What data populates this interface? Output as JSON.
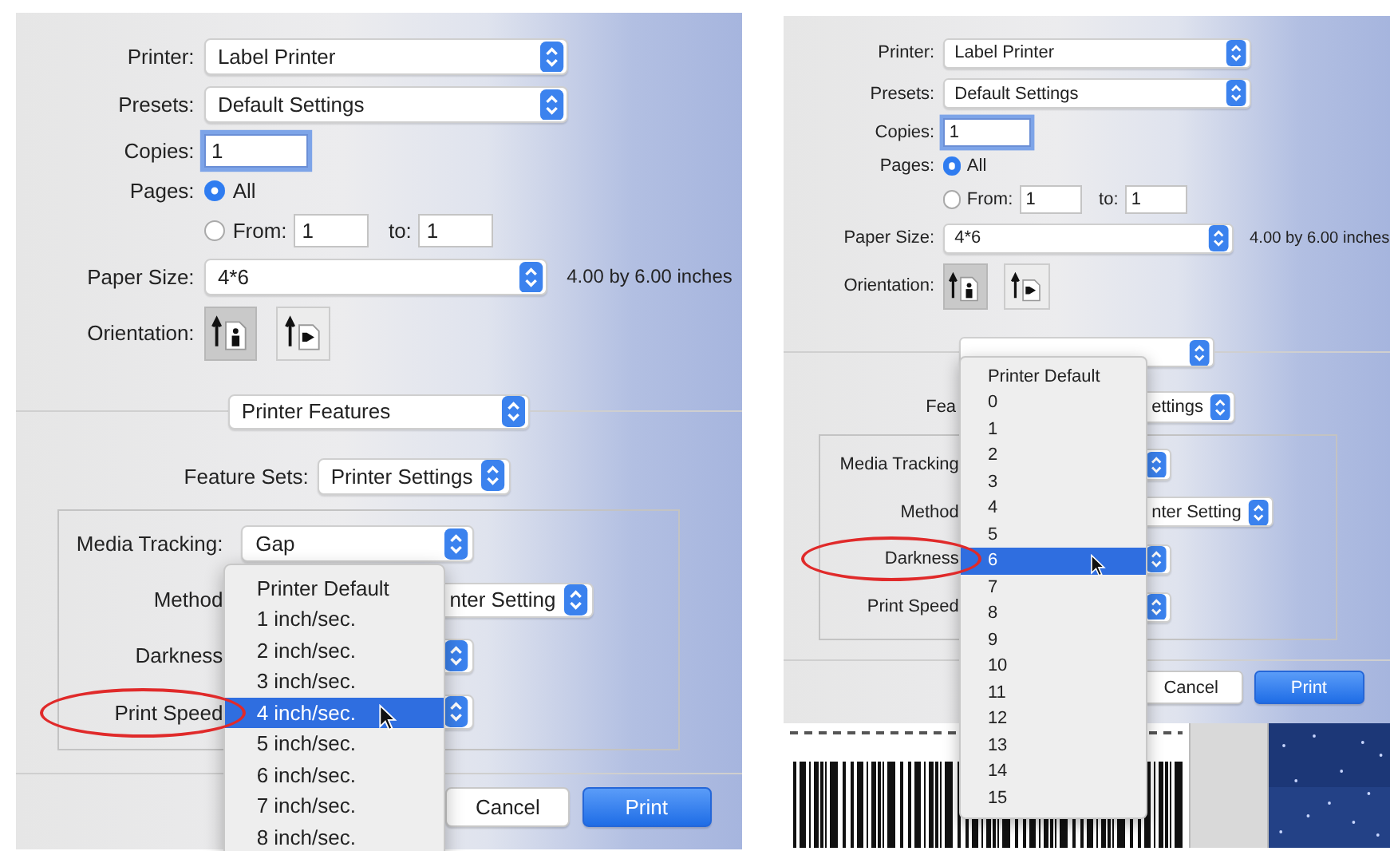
{
  "panels": [
    {
      "printer": {
        "label": "Printer:",
        "value": "Label Printer"
      },
      "presets": {
        "label": "Presets:",
        "value": "Default Settings"
      },
      "copies": {
        "label": "Copies:",
        "value": "1",
        "focused": true
      },
      "pages": {
        "label": "Pages:",
        "all": {
          "label": "All",
          "selected": true
        },
        "range": {
          "label": "From:",
          "selected": false,
          "from": "1",
          "to_label": "to:",
          "to": "1"
        }
      },
      "paper_size": {
        "label": "Paper Size:",
        "value": "4*6",
        "note": "4.00 by 6.00 inches"
      },
      "orientation": {
        "label": "Orientation:",
        "options": [
          {
            "kind": "portrait",
            "selected": true
          },
          {
            "kind": "landscape",
            "selected": false
          }
        ]
      },
      "section": {
        "value": "Printer Features"
      },
      "feature_sets": {
        "label": "Feature Sets:",
        "value": "Printer Settings"
      },
      "settings": [
        {
          "label": "Media Tracking:",
          "value": "Gap",
          "highlighted": false
        },
        {
          "label": "Method",
          "value": "nter Setting",
          "highlighted": false
        },
        {
          "label": "Darkness",
          "highlighted": false
        },
        {
          "label": "Print Speed",
          "highlighted": true
        }
      ],
      "menu": {
        "items": [
          {
            "label": "Printer Default",
            "selected": false
          },
          {
            "label": "1 inch/sec.",
            "selected": false
          },
          {
            "label": "2 inch/sec.",
            "selected": false
          },
          {
            "label": "3 inch/sec.",
            "selected": false
          },
          {
            "label": "4 inch/sec.",
            "selected": true
          },
          {
            "label": "5 inch/sec.",
            "selected": false
          },
          {
            "label": "6 inch/sec.",
            "selected": false
          },
          {
            "label": "7 inch/sec.",
            "selected": false
          },
          {
            "label": "8 inch/sec.",
            "selected": false
          }
        ]
      },
      "buttons": [
        {
          "label": "Cancel",
          "kind": "secondary"
        },
        {
          "label": "Print",
          "kind": "default"
        }
      ]
    },
    {
      "printer": {
        "label": "Printer:",
        "value": "Label Printer"
      },
      "presets": {
        "label": "Presets:",
        "value": "Default Settings"
      },
      "copies": {
        "label": "Copies:",
        "value": "1",
        "focused": true
      },
      "pages": {
        "label": "Pages:",
        "all": {
          "label": "All",
          "selected": true
        },
        "range": {
          "label": "From:",
          "selected": false,
          "from": "1",
          "to_label": "to:",
          "to": "1"
        }
      },
      "paper_size": {
        "label": "Paper Size:",
        "value": "4*6",
        "note": "4.00 by 6.00 inches"
      },
      "orientation": {
        "label": "Orientation:",
        "options": [
          {
            "kind": "portrait",
            "selected": true
          },
          {
            "kind": "landscape",
            "selected": false
          }
        ]
      },
      "feature_sets": {
        "label": "Fea",
        "value": "ettings"
      },
      "settings": [
        {
          "label": "Media Tracking",
          "highlighted": false
        },
        {
          "label": "Method",
          "value": "nter Setting",
          "highlighted": false
        },
        {
          "label": "Darkness",
          "highlighted": true
        },
        {
          "label": "Print Speed",
          "highlighted": false
        }
      ],
      "menu": {
        "items": [
          {
            "label": "Printer Default",
            "selected": false
          },
          {
            "label": "0",
            "selected": false
          },
          {
            "label": "1",
            "selected": false
          },
          {
            "label": "2",
            "selected": false
          },
          {
            "label": "3",
            "selected": false
          },
          {
            "label": "4",
            "selected": false
          },
          {
            "label": "5",
            "selected": false
          },
          {
            "label": "6",
            "selected": true
          },
          {
            "label": "7",
            "selected": false
          },
          {
            "label": "8",
            "selected": false
          },
          {
            "label": "9",
            "selected": false
          },
          {
            "label": "10",
            "selected": false
          },
          {
            "label": "11",
            "selected": false
          },
          {
            "label": "12",
            "selected": false
          },
          {
            "label": "13",
            "selected": false
          },
          {
            "label": "14",
            "selected": false
          },
          {
            "label": "15",
            "selected": false
          }
        ]
      },
      "buttons": [
        {
          "label": "Cancel",
          "kind": "secondary"
        },
        {
          "label": "Print",
          "kind": "default"
        }
      ],
      "preview": [
        {
          "kind": "barcode"
        },
        {
          "kind": "picture"
        }
      ]
    }
  ]
}
